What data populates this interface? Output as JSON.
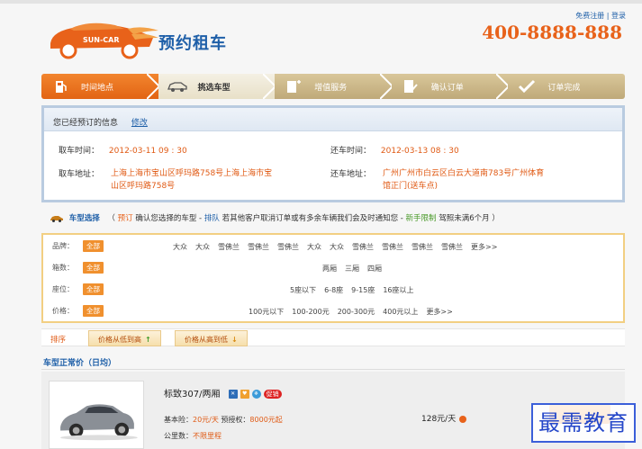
{
  "header": {
    "logo_text": "SUN-CAR",
    "brand": "预约租车",
    "register": "免费注册",
    "separator": "|",
    "login": "登录",
    "phone": "400-8888-888"
  },
  "steps": [
    {
      "label": "时间地点",
      "state": "done"
    },
    {
      "label": "挑选车型",
      "state": "current"
    },
    {
      "label": "增值服务",
      "state": "todo"
    },
    {
      "label": "确认订单",
      "state": "todo"
    },
    {
      "label": "订单完成",
      "state": "todo"
    }
  ],
  "booked": {
    "title": "您已经预订的信息",
    "edit": "修改",
    "pickup_time_label": "取车时间：",
    "pickup_time": "2012-03-11 09 : 30",
    "return_time_label": "还车时间：",
    "return_time": "2012-03-13 08 : 30",
    "pickup_addr_label": "取车地址：",
    "pickup_addr_line1": "上海上海市宝山区呼玛路758号上海上海市宝",
    "pickup_addr_line2": "山区呼玛路758号",
    "return_addr_label": "还车地址：",
    "return_addr_line1": "广州广州市白云区白云大道南783号广州体育",
    "return_addr_line2": "馆正门(送车点)"
  },
  "select": {
    "title": "车型选择",
    "note_open": "（",
    "reserve": "预订",
    "note1": "确认您选择的车型 -",
    "queue": "排队",
    "note2": "若其他客户取消订单或有多余车辆我们会及时通知您 -",
    "newlimit": "新手限制",
    "note3": "驾照未满6个月",
    "note_close": "）"
  },
  "filters": [
    {
      "label": "品牌：",
      "all": "全部",
      "options": [
        "大众",
        "大众",
        "雪佛兰",
        "雪佛兰",
        "雪佛兰",
        "大众",
        "大众",
        "雪佛兰",
        "雪佛兰",
        "雪佛兰",
        "雪佛兰",
        "更多>>"
      ]
    },
    {
      "label": "箱数：",
      "all": "全部",
      "options": [
        "两厢",
        "三厢",
        "四厢"
      ]
    },
    {
      "label": "座位：",
      "all": "全部",
      "options": [
        "5座以下",
        "6-8座",
        "9-15座",
        "16座以上"
      ]
    },
    {
      "label": "价格：",
      "all": "全部",
      "options": [
        "100元以下",
        "100-200元",
        "200-300元",
        "400元以上",
        "更多>>"
      ]
    }
  ],
  "sort": {
    "label": "排序",
    "asc": "价格从低到高",
    "asc_arrow": "↑",
    "desc": "价格从高到低",
    "desc_arrow": "↓"
  },
  "price_section": "车型正常价（日均）",
  "car": {
    "name": "标致307/两厢",
    "sale": "促销",
    "base_label": "基本险：",
    "base_val": "20元/天",
    "deposit_label": "预授权：",
    "deposit_val": "8000元起",
    "miles_label": "公里数：",
    "miles_val": "不限里程",
    "price": "128元/天"
  },
  "watermark": "最需教育",
  "colors": {
    "accent": "#e8621a",
    "brand_blue": "#1e5fa8"
  }
}
